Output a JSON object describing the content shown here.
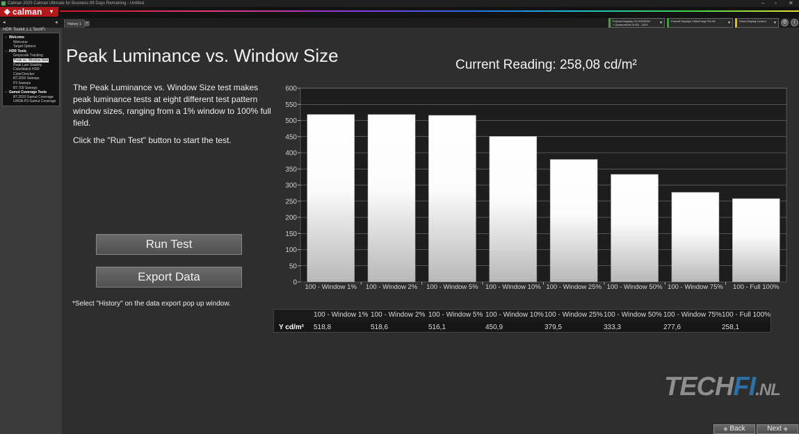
{
  "window": {
    "title": "Calman 2025 Calman Ultimate for Business 89 Days Remaining - Untitled",
    "controls": [
      "–",
      "▫",
      "✕"
    ]
  },
  "app": {
    "logo": "calman"
  },
  "sidebar": {
    "workflow_title": "HDR Toolkit 1.1 TechFi",
    "tree": [
      {
        "label": "Welcome",
        "level": 0,
        "bold": true
      },
      {
        "label": "Welcome",
        "level": 1
      },
      {
        "label": "Target Options",
        "level": 1
      },
      {
        "label": "HDR Tests",
        "level": 0,
        "bold": true
      },
      {
        "label": "Grayscale Tracking",
        "level": 1
      },
      {
        "label": "Peak vs. Window Size",
        "level": 1,
        "selected": true
      },
      {
        "label": "Peak Lum Stability",
        "level": 1
      },
      {
        "label": "ColorMatch HDR",
        "level": 1
      },
      {
        "label": "ColorChecker",
        "level": 1
      },
      {
        "label": "BT.2020 Sweeps",
        "level": 1
      },
      {
        "label": "P3 Sweeps",
        "level": 1
      },
      {
        "label": "BT.709 Sweeps",
        "level": 1
      },
      {
        "label": "Gamut Coverage Tests",
        "level": 0,
        "bold": true
      },
      {
        "label": "BT.2020 Gamut Coverage",
        "level": 1
      },
      {
        "label": "UHDA-P3 Gamut Coverage",
        "level": 1
      }
    ]
  },
  "tabs": [
    {
      "label": "History 1"
    }
  ],
  "devices": [
    {
      "line1": "Portrait Displays C6 HDR5000",
      "line2": "+ QuantumDot OLED - 2023",
      "accent": "#3aa63a"
    },
    {
      "line1": "Portrait Displays VideoForge Pro 8K",
      "line2": "",
      "accent": "#3aa63a"
    },
    {
      "line1": "Direct Display Control",
      "line2": "",
      "accent": "#d8c21d"
    }
  ],
  "page": {
    "title": "Peak Luminance vs. Window Size",
    "current_reading": "Current Reading: 258,08 cd/m²",
    "description": "The Peak Luminance vs. Window Size test makes peak luminance tests at eight different test pattern window sizes, ranging from a 1% window to 100% full field.",
    "instruction": "Click the \"Run Test\" button to start the test.",
    "run_button": "Run Test",
    "export_button": "Export  Data",
    "export_note": "*Select \"History\" on the data export pop up window."
  },
  "chart_data": {
    "type": "bar",
    "categories": [
      "100 - Window  1%",
      "100 - Window  2%",
      "100 - Window  5%",
      "100 - Window 10%",
      "100 - Window 25%",
      "100 - Window 50%",
      "100 - Window 75%",
      "100 - Full  100%"
    ],
    "values": [
      518.8,
      518.6,
      516.1,
      450.9,
      379.5,
      333.3,
      277.6,
      258.1
    ],
    "ylim": [
      0,
      600
    ],
    "yticks": [
      "0",
      "50",
      "100",
      "150",
      "200",
      "250",
      "300",
      "350",
      "400",
      "450",
      "500",
      "550",
      "600"
    ],
    "grid": true,
    "bar_color": "#ffffff"
  },
  "table": {
    "row_label": "Y cd/m²",
    "headers": [
      "100 - Window  1%",
      "100 - Window  2%",
      "100 - Window  5%",
      "100 - Window 10%",
      "100 - Window 25%",
      "100 - Window 50%",
      "100 - Window 75%",
      "100 - Full  100%"
    ],
    "values": [
      "518,8",
      "518,6",
      "516,1",
      "450,9",
      "379,5",
      "333,3",
      "277,6",
      "258,1"
    ]
  },
  "watermark": {
    "part1": "TECH",
    "part2": "FI",
    "part3": ".NL"
  },
  "nav": {
    "back": "Back",
    "next": "Next"
  }
}
